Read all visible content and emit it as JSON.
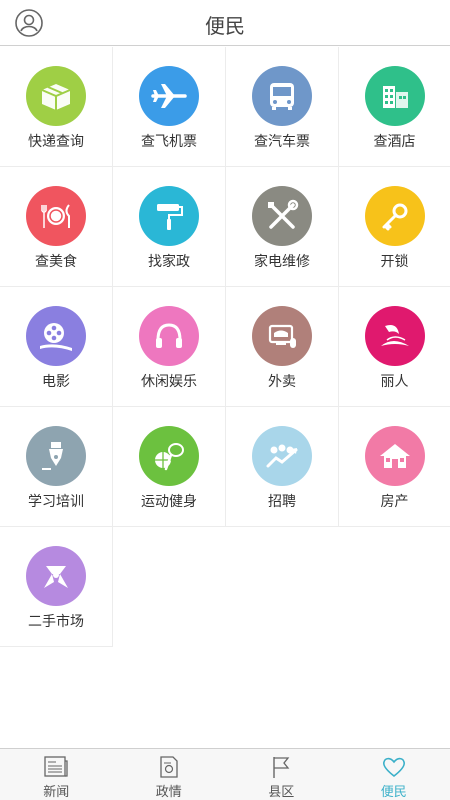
{
  "header": {
    "title": "便民"
  },
  "services": [
    {
      "label": "快递查询",
      "icon": "package-icon",
      "color": "#9fcf45"
    },
    {
      "label": "查飞机票",
      "icon": "airplane-icon",
      "color": "#3b9ce8"
    },
    {
      "label": "查汽车票",
      "icon": "bus-icon",
      "color": "#6f97c9"
    },
    {
      "label": "查酒店",
      "icon": "hotel-icon",
      "color": "#2fc08a"
    },
    {
      "label": "查美食",
      "icon": "dining-icon",
      "color": "#f0555f"
    },
    {
      "label": "找家政",
      "icon": "paint-roller-icon",
      "color": "#2ab7d6"
    },
    {
      "label": "家电维修",
      "icon": "tools-icon",
      "color": "#8a8a82"
    },
    {
      "label": "开锁",
      "icon": "key-icon",
      "color": "#f7c21a"
    },
    {
      "label": "电影",
      "icon": "film-reel-icon",
      "color": "#8a7fe0"
    },
    {
      "label": "休闲娱乐",
      "icon": "headphones-icon",
      "color": "#ee77bf"
    },
    {
      "label": "外卖",
      "icon": "takeout-icon",
      "color": "#b0807a"
    },
    {
      "label": "丽人",
      "icon": "beauty-icon",
      "color": "#e0196e"
    },
    {
      "label": "学习培训",
      "icon": "pen-nib-icon",
      "color": "#8ea4b0"
    },
    {
      "label": "运动健身",
      "icon": "sports-ball-icon",
      "color": "#6cc13f"
    },
    {
      "label": "招聘",
      "icon": "recruit-people-icon",
      "color": "#a9d6ea"
    },
    {
      "label": "房产",
      "icon": "house-icon",
      "color": "#f27aa6"
    },
    {
      "label": "二手市场",
      "icon": "gift-bow-icon",
      "color": "#b68ae0"
    }
  ],
  "tabs": [
    {
      "label": "新闻",
      "icon": "newspaper-icon",
      "active": false
    },
    {
      "label": "政情",
      "icon": "document-icon",
      "active": false
    },
    {
      "label": "县区",
      "icon": "flag-icon",
      "active": false
    },
    {
      "label": "便民",
      "icon": "heart-icon",
      "active": true
    }
  ],
  "colors": {
    "accent": "#3bb0c9"
  }
}
